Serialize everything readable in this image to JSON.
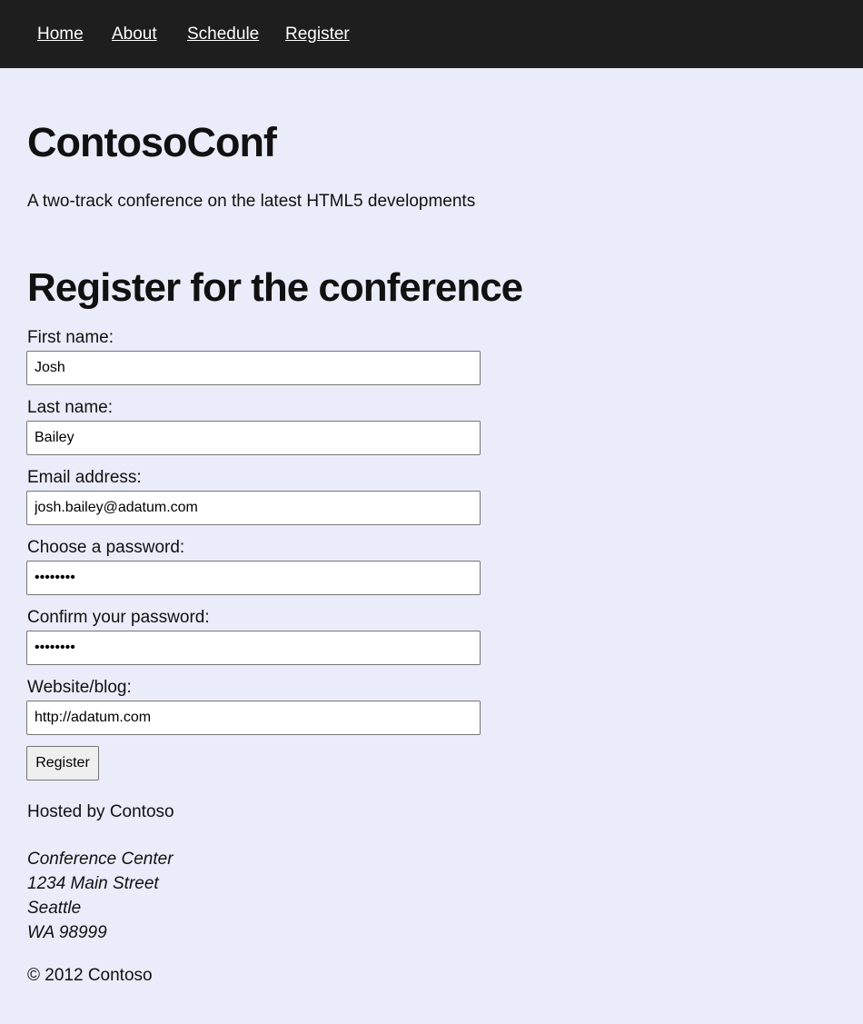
{
  "nav": {
    "items": [
      "Home",
      "About",
      "Schedule",
      "Register"
    ]
  },
  "header": {
    "title": "ContosoConf",
    "tagline": "A two-track conference on the latest HTML5 developments"
  },
  "form": {
    "heading": "Register for the conference",
    "fields": [
      {
        "label": "First name:",
        "value": "Josh",
        "type": "text"
      },
      {
        "label": "Last name:",
        "value": "Bailey",
        "type": "text"
      },
      {
        "label": "Email address:",
        "value": "josh.bailey@adatum.com",
        "type": "email"
      },
      {
        "label": "Choose a password:",
        "value": "••••••••",
        "type": "password"
      },
      {
        "label": "Confirm your password:",
        "value": "••••••••",
        "type": "password"
      },
      {
        "label": "Website/blog:",
        "value": "http://adatum.com",
        "type": "url"
      }
    ],
    "submit_label": "Register"
  },
  "footer": {
    "hosted_by": "Hosted by Contoso",
    "address": [
      "Conference Center",
      "1234 Main Street",
      "Seattle",
      "WA 98999"
    ],
    "copyright": "© 2012 Contoso"
  }
}
